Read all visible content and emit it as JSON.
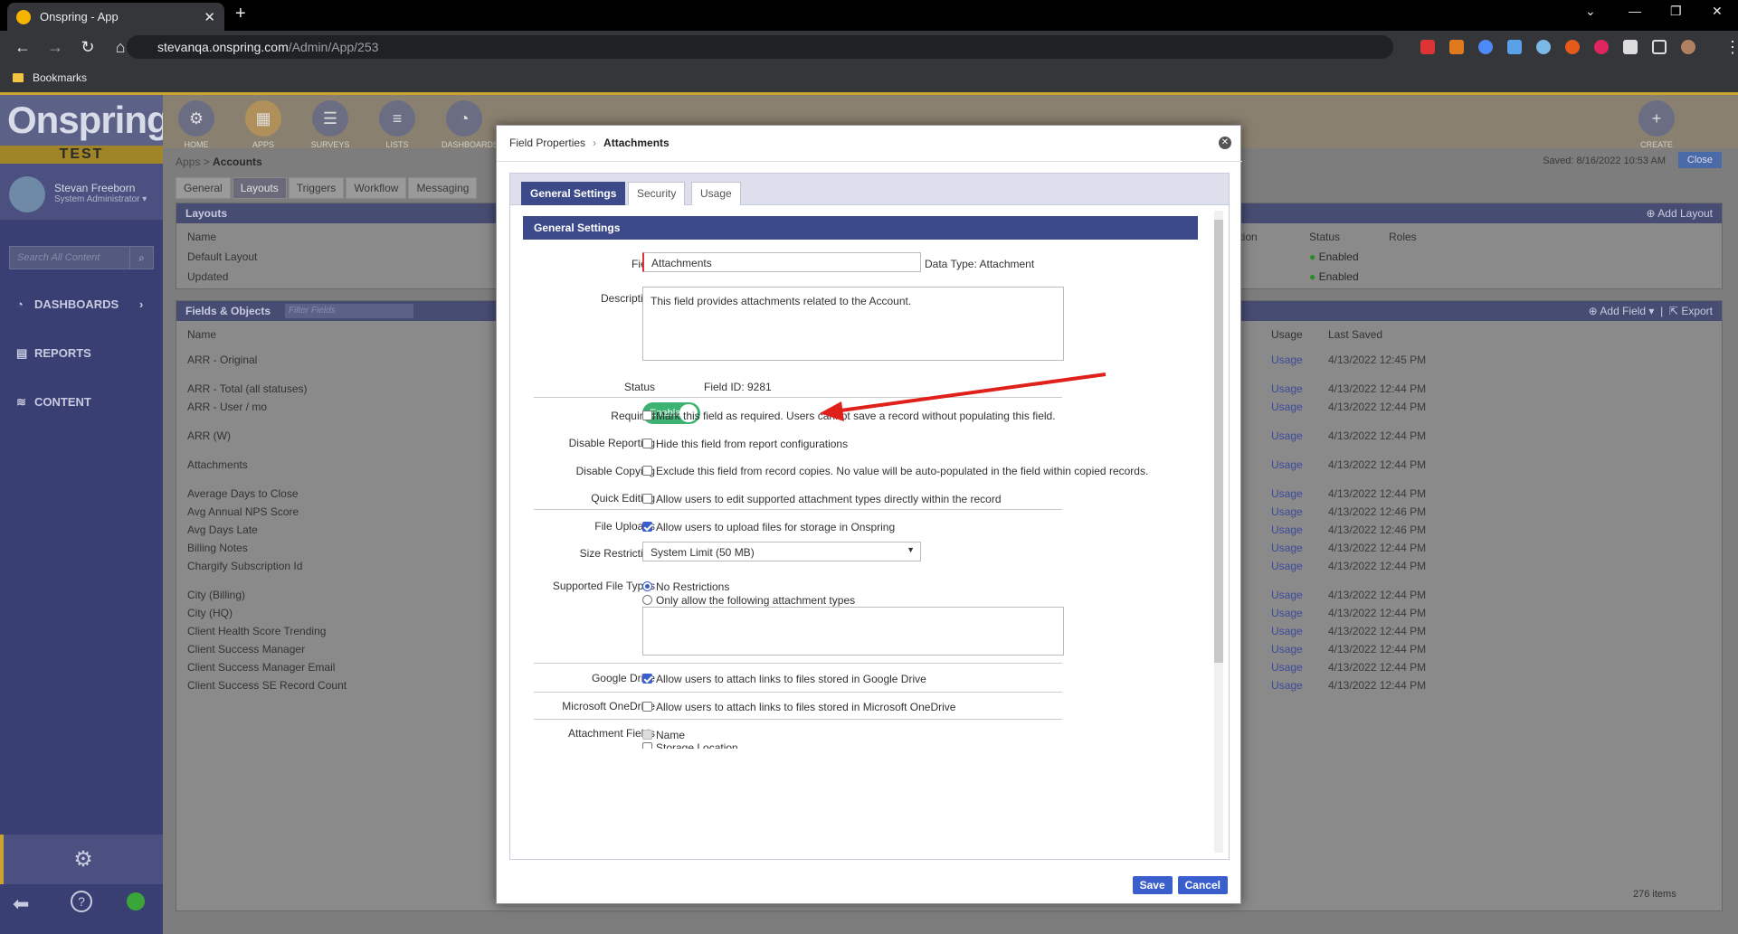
{
  "browser": {
    "tab_title": "Onspring - App",
    "url_host": "stevanqa.onspring.com",
    "url_path": "/Admin/App/253",
    "bookmarks_label": "Bookmarks"
  },
  "sidebar": {
    "logo": "Onspring",
    "env": "TEST",
    "user_name": "Stevan Freeborn",
    "user_role": "System Administrator ▾",
    "search_placeholder": "Search All Content",
    "nav": [
      "DASHBOARDS",
      "REPORTS",
      "CONTENT"
    ]
  },
  "header": {
    "buttons": [
      "HOME",
      "APPS",
      "SURVEYS",
      "LISTS",
      "DASHBOARDS"
    ],
    "create": "CREATE"
  },
  "main": {
    "breadcrumb_root": "Apps",
    "breadcrumb_current": "Accounts",
    "saved": "Saved: 8/16/2022 10:53 AM",
    "close": "Close",
    "tabs": [
      "General",
      "Layouts",
      "Triggers",
      "Workflow",
      "Messaging"
    ],
    "layouts_title": "Layouts",
    "add_layout": "Add Layout",
    "layouts_cols": [
      "Name",
      "Position",
      "Status",
      "Roles"
    ],
    "layouts_rows": [
      {
        "name": "Default Layout",
        "status": "Enabled"
      },
      {
        "name": "Updated",
        "status": "Enabled"
      }
    ],
    "fields_title": "Fields & Objects",
    "filter_placeholder": "Filter Fields",
    "add_field": "Add Field ▾",
    "export": "Export",
    "fields_cols": [
      "Name",
      "Usage",
      "Last Saved"
    ],
    "fields_rows": [
      {
        "name": "ARR - Original",
        "usage": "Usage",
        "date": "4/13/2022 12:45 PM"
      },
      {
        "name": "ARR - Total (all statuses)",
        "usage": "Usage",
        "date": "4/13/2022 12:44 PM"
      },
      {
        "name": "ARR - User / mo",
        "usage": "Usage",
        "date": "4/13/2022 12:44 PM"
      },
      {
        "name": "ARR (W)",
        "usage": "Usage",
        "date": "4/13/2022 12:44 PM"
      },
      {
        "name": "Attachments",
        "usage": "Usage",
        "date": "4/13/2022 12:44 PM"
      },
      {
        "name": "Average Days to Close",
        "usage": "Usage",
        "date": "4/13/2022 12:44 PM"
      },
      {
        "name": "Avg Annual NPS Score",
        "usage": "Usage",
        "date": "4/13/2022 12:46 PM"
      },
      {
        "name": "Avg Days Late",
        "usage": "Usage",
        "date": "4/13/2022 12:46 PM"
      },
      {
        "name": "Billing Notes",
        "usage": "Usage",
        "date": "4/13/2022 12:44 PM"
      },
      {
        "name": "Chargify Subscription Id",
        "usage": "Usage",
        "date": "4/13/2022 12:44 PM"
      },
      {
        "name": "City (Billing)",
        "usage": "Usage",
        "date": "4/13/2022 12:44 PM"
      },
      {
        "name": "City (HQ)",
        "usage": "Usage",
        "date": "4/13/2022 12:44 PM"
      },
      {
        "name": "Client Health Score Trending",
        "usage": "Usage",
        "date": "4/13/2022 12:44 PM"
      },
      {
        "name": "Client Success Manager",
        "usage": "Usage",
        "date": "4/13/2022 12:44 PM"
      },
      {
        "name": "Client Success Manager Email",
        "usage": "Usage",
        "date": "4/13/2022 12:44 PM"
      },
      {
        "name": "Client Success SE Record Count",
        "usage": "Usage",
        "date": "4/13/2022 12:44 PM"
      }
    ],
    "item_count": "276 items"
  },
  "modal": {
    "crumb_root": "Field Properties",
    "crumb_current": "Attachments",
    "tabs": [
      "General Settings",
      "Security",
      "Usage"
    ],
    "section_title": "General Settings",
    "field_label": "Field",
    "field_value": "Attachments",
    "data_type": "Data Type: Attachment",
    "description_label": "Description",
    "description_value": "This field provides attachments related to the Account.",
    "status_label": "Status",
    "status_toggle": "Enabled",
    "field_id": "Field ID: 9281",
    "required_label": "Required",
    "required_text": "Mark this field as required. Users cannot save a record without populating this field.",
    "disable_reporting_label": "Disable Reporting",
    "disable_reporting_text": "Hide this field from report configurations",
    "disable_copying_label": "Disable Copying",
    "disable_copying_text": "Exclude this field from record copies. No value will be auto-populated in the field within copied records.",
    "quick_editing_label": "Quick Editing",
    "quick_editing_text": "Allow users to edit supported attachment types directly within the record",
    "file_uploads_label": "File Uploads",
    "file_uploads_text": "Allow users to upload files for storage in Onspring",
    "size_restriction_label": "Size Restriction",
    "size_restriction_value": "System Limit (50 MB)",
    "supported_types_label": "Supported File Types",
    "no_restrictions": "No Restrictions",
    "only_allow": "Only allow the following attachment types",
    "google_drive_label": "Google Drive",
    "google_drive_text": "Allow users to attach links to files stored in Google Drive",
    "onedrive_label": "Microsoft OneDrive",
    "onedrive_text": "Allow users to attach links to files stored in Microsoft OneDrive",
    "attachment_fields_label": "Attachment Fields",
    "attachment_field_name": "Name",
    "attachment_field_storage": "Storage Location",
    "save": "Save",
    "cancel": "Cancel"
  },
  "colors": {
    "accent": "#3d4a8a",
    "toggle_on": "#3cb371",
    "annotation_arrow": "#e0201b"
  }
}
